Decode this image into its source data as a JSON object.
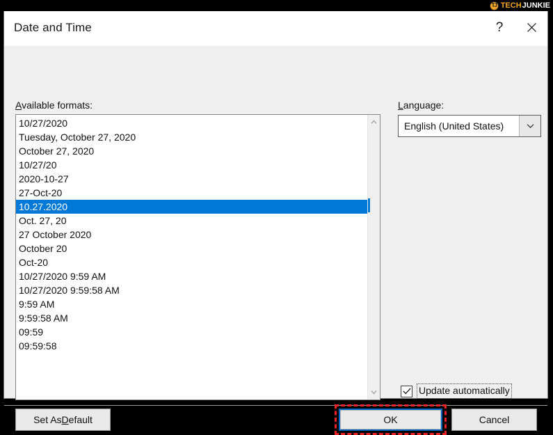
{
  "watermark": {
    "logo_text": "TJ",
    "brand_part1": "TECH",
    "brand_part2": "JUNKIE"
  },
  "dialog": {
    "title": "Date and Time",
    "help_icon": "?",
    "close_icon": "✕"
  },
  "labels": {
    "available_formats_underlined": "A",
    "available_formats_rest": "vailable formats:",
    "language_underlined": "L",
    "language_rest": "anguage:"
  },
  "formats": {
    "selected_index": 6,
    "items": [
      "10/27/2020",
      "Tuesday, October 27, 2020",
      "October 27, 2020",
      "10/27/20",
      "2020-10-27",
      "27-Oct-20",
      "10.27.2020",
      "Oct. 27, 20",
      "27 October 2020",
      "October 20",
      "Oct-20",
      "10/27/2020 9:59 AM",
      "10/27/2020 9:59:58 AM",
      "9:59 AM",
      "9:59:58 AM",
      "09:59",
      "09:59:58"
    ]
  },
  "language": {
    "value": "English (United States)",
    "chevron_icon": "chevron-down"
  },
  "update_automatically": {
    "checked": true,
    "underlined": "U",
    "rest": "pdate automatically"
  },
  "buttons": {
    "set_as_default_pre": "Set As ",
    "set_as_default_underlined": "D",
    "set_as_default_post": "efault",
    "ok": "OK",
    "cancel": "Cancel"
  },
  "colors": {
    "selection_blue": "#0078d7",
    "focus_border_blue": "#0067c0",
    "annotation_red": "#ec2227",
    "brand_orange": "#f5a623",
    "dialog_bg": "#f0f0f0"
  }
}
